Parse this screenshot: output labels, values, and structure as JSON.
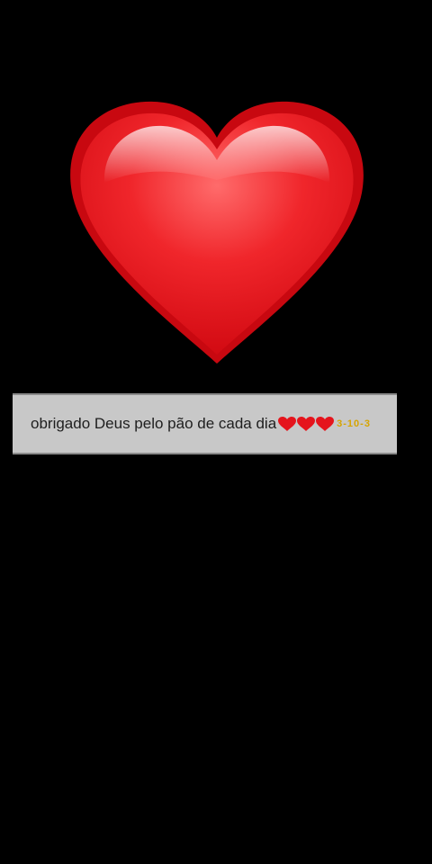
{
  "screen": {
    "background": "#000000",
    "main_icon": "red-heart-icon",
    "heart_color": "#e8141c"
  },
  "caption": {
    "text": "obrigado Deus pelo pão de cada dia",
    "emoji_hearts": [
      "red-heart-emoji",
      "red-heart-emoji",
      "red-heart-emoji"
    ],
    "suffix": "3-10-3",
    "bar_color": "#c8c8c8"
  }
}
